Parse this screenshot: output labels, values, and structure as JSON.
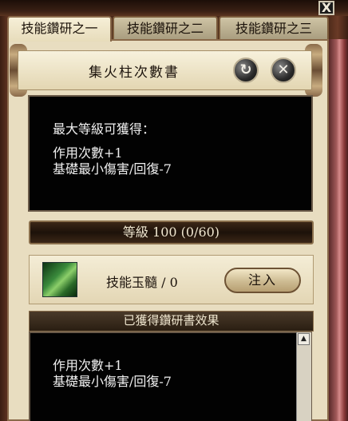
{
  "window": {
    "close_label": "X",
    "tabs": [
      {
        "label": "技能鑽研之一",
        "active": true
      },
      {
        "label": "技能鑽研之二",
        "active": false
      },
      {
        "label": "技能鑽研之三",
        "active": false
      }
    ]
  },
  "header": {
    "title": "集火柱次數書",
    "reset_icon": "reset-icon",
    "cancel_icon": "close-icon"
  },
  "preview": {
    "heading": "最大等級可獲得：",
    "lines": [
      "作用次數+1",
      "基礎最小傷害/回復-7"
    ]
  },
  "level": {
    "text": "等級 100 (0/60)"
  },
  "item": {
    "label": "技能玉髓 / 0",
    "inject_button": "注入",
    "icon": "jade-icon"
  },
  "acquired": {
    "title": "已獲得鑽研書效果",
    "lines": [
      "作用次數+1",
      "基礎最小傷害/回復-7"
    ]
  },
  "colors": {
    "accent_gold": "#c8ac80",
    "panel_bg": "#e8ddc0",
    "text_light": "#f0f0f0"
  }
}
